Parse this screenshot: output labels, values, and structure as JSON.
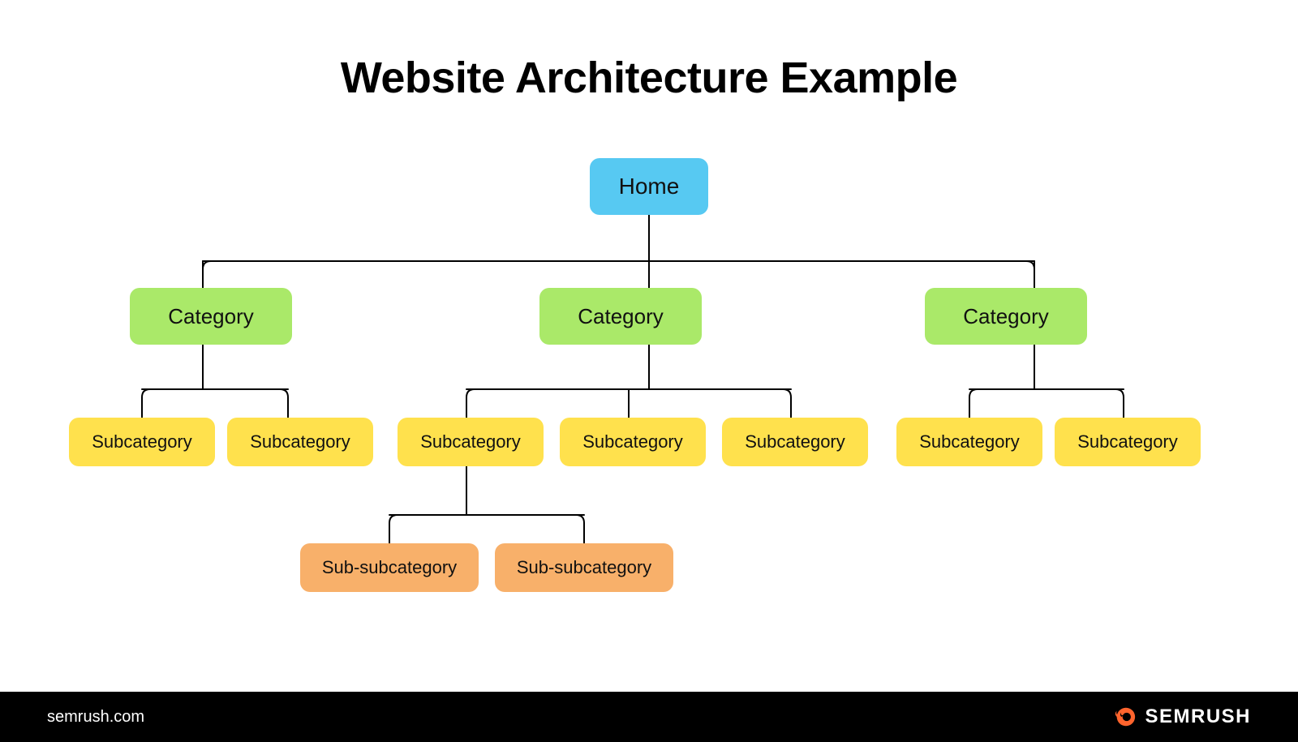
{
  "title": "Website Architecture Example",
  "colors": {
    "home": "#57c9f2",
    "category": "#aae969",
    "subcategory": "#ffe14d",
    "subsubcategory": "#f8b06a",
    "footer_bg": "#000000",
    "footer_text": "#ffffff",
    "brand_accent": "#ff642d"
  },
  "hierarchy": {
    "root": {
      "label": "Home",
      "children": [
        {
          "label": "Category",
          "children": [
            {
              "label": "Subcategory"
            },
            {
              "label": "Subcategory"
            }
          ]
        },
        {
          "label": "Category",
          "children": [
            {
              "label": "Subcategory",
              "children": [
                {
                  "label": "Sub-subcategory"
                },
                {
                  "label": "Sub-subcategory"
                }
              ]
            },
            {
              "label": "Subcategory"
            },
            {
              "label": "Subcategory"
            }
          ]
        },
        {
          "label": "Category",
          "children": [
            {
              "label": "Subcategory"
            },
            {
              "label": "Subcategory"
            }
          ]
        }
      ]
    }
  },
  "footer": {
    "site": "semrush.com",
    "brand": "SEMRUSH"
  }
}
